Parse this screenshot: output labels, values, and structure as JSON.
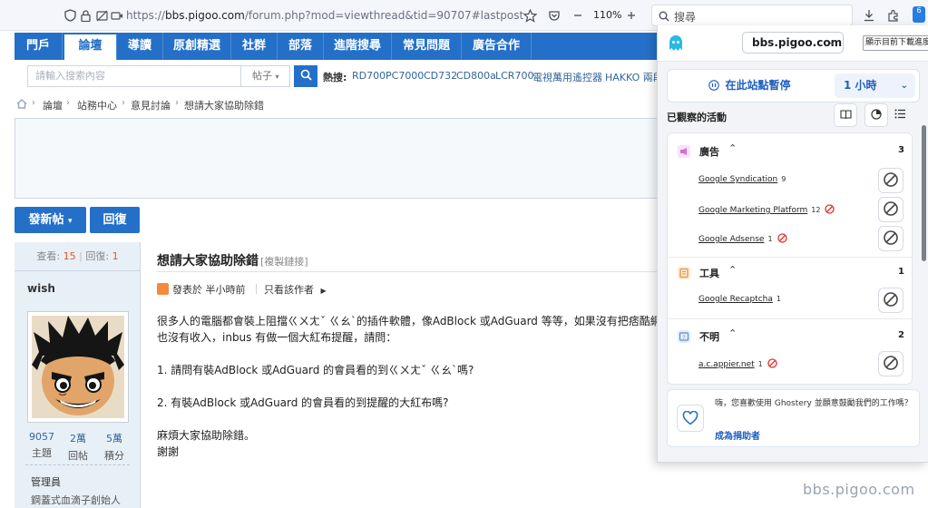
{
  "browser": {
    "url_prefix": "https://",
    "url_host": "bbs.pigoo.com",
    "url_path": "/forum.php?mod=viewthread&tid=90707#lastpost",
    "zoom": "110%",
    "search_placeholder": "搜尋",
    "extension_badge_count": "6"
  },
  "nav": {
    "items": [
      "門戶",
      "論壇",
      "導讀",
      "原創精選",
      "社群",
      "部落",
      "進階搜尋",
      "常見問題",
      "廣告合作"
    ],
    "active_index": 1
  },
  "search": {
    "placeholder": "請輸入搜索內容",
    "type": "帖子",
    "hot_label": "熱搜:",
    "hot_links": [
      "RD700",
      "PC7000",
      "CD732",
      "CD800a",
      "LCR700",
      "電視萬用遙控器",
      "HAKKO 兩段"
    ]
  },
  "breadcrumb": [
    "論壇",
    "站務中心",
    "意見討論",
    "想請大家協助除錯"
  ],
  "buttons": {
    "new_post": "發新帖",
    "reply": "回復"
  },
  "thread": {
    "views_label": "查看:",
    "views": "15",
    "replies_label": "回復:",
    "replies": "1",
    "title": "想請大家協助除錯",
    "copy_link": "[複製鏈接]",
    "posted_prefix": "發表於",
    "posted_time": "半小時前",
    "author_only": "只看該作者",
    "body": [
      "很多人的電腦都會裝上阻擋ㄍㄨㄤˇ ㄍㄠˋ的插件軟體，像AdBlock 或AdGuard 等等，如果沒有把痞酷網加",
      "也沒有收入，inbus 有做一個大紅布提醒，請問：",
      "",
      "1. 請問有裝AdBlock 或AdGuard 的會員看的到ㄍㄨㄤˇ ㄍㄠˋ嗎?",
      "",
      "2. 有裝AdBlock 或AdGuard 的會員看的到提醒的大紅布嗎?",
      "",
      "麻煩大家協助除錯。",
      "謝謝"
    ]
  },
  "author": {
    "name": "wish",
    "stats": [
      {
        "value": "9057",
        "label": "主題"
      },
      {
        "value": "2萬",
        "label": "回帖"
      },
      {
        "value": "5萬",
        "label": "積分"
      }
    ],
    "role": "管理員",
    "title": "鋼蓋式血滴子創始人"
  },
  "watermark": "bbs.pigoo.com",
  "ghostery": {
    "domain": "bbs.pigoo.com",
    "download_btn": "顯示目前下載進度",
    "pause_label": "在此站點暫停",
    "duration": "1 小時",
    "observed_label": "已觀察的活動",
    "categories": [
      {
        "name": "廣告",
        "count": "3",
        "color": "#d96ad8",
        "trackers": [
          {
            "name": "Google Syndication",
            "count": "9",
            "blocked": false
          },
          {
            "name": "Google Marketing Platform",
            "count": "12",
            "blocked": true
          },
          {
            "name": "Google Adsense",
            "count": "1",
            "blocked": true
          }
        ]
      },
      {
        "name": "工具",
        "count": "1",
        "color": "#e8913a",
        "trackers": [
          {
            "name": "Google Recaptcha",
            "count": "1",
            "blocked": false
          }
        ]
      },
      {
        "name": "不明",
        "count": "2",
        "color": "#5b8fd6",
        "trackers": [
          {
            "name": "a.c.appier.net",
            "count": "1",
            "blocked": true
          }
        ]
      }
    ],
    "support_text": "嗨，您喜歡使用 Ghostery 並願意鼓勵我們的工作嗎？",
    "support_link": "成為捐助者"
  }
}
